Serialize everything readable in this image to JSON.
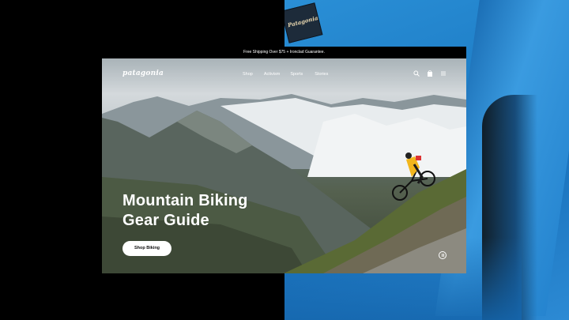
{
  "promo": {
    "text": "Free Shipping Over $75 + Ironclad Guarantee."
  },
  "header": {
    "logo": "patagonia",
    "nav": [
      "Shop",
      "Activism",
      "Sports",
      "Stories"
    ],
    "icons": [
      "search-icon",
      "bag-icon",
      "menu-icon"
    ]
  },
  "hero": {
    "headline_line1": "Mountain Biking",
    "headline_line2": "Gear Guide",
    "cta_label": "Shop Biking",
    "control_icon": "pause-icon"
  },
  "backdrop": {
    "label_text": "Patagonia",
    "jacket_color": "#1f7fc8"
  },
  "colors": {
    "background": "#000000",
    "text": "#ffffff",
    "button_bg": "#ffffff"
  }
}
